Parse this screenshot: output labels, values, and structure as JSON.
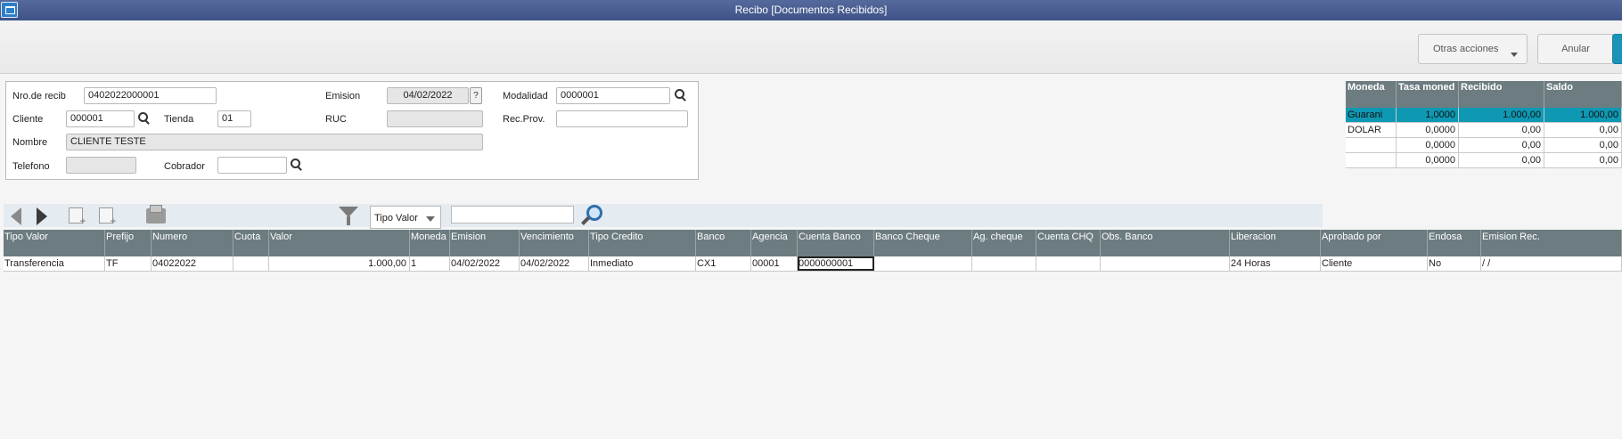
{
  "window": {
    "title": "Recibo [Documentos Recibidos]"
  },
  "actions": {
    "more_label": "Otras acciones",
    "cancel_label": "Anular"
  },
  "form": {
    "nro_recib": {
      "label": "Nro.de recib",
      "value": "0402022000001"
    },
    "emision": {
      "label": "Emision",
      "value": "04/02/2022",
      "help": "?"
    },
    "modalidad": {
      "label": "Modalidad",
      "value": "0000001"
    },
    "cliente": {
      "label": "Cliente",
      "value": "000001"
    },
    "tienda": {
      "label": "Tienda",
      "value": "01"
    },
    "ruc": {
      "label": "RUC",
      "value": ""
    },
    "rec_prov": {
      "label": "Rec.Prov.",
      "value": ""
    },
    "nombre": {
      "label": "Nombre",
      "value": "CLIENTE TESTE"
    },
    "telefono": {
      "label": "Telefono",
      "value": ""
    },
    "cobrador": {
      "label": "Cobrador",
      "value": ""
    }
  },
  "currency_table": {
    "columns": [
      "Moneda",
      "Tasa moned",
      "Recibido",
      "Saldo"
    ],
    "rows": [
      {
        "moneda": "Guarani",
        "tasa": "1,0000",
        "recibido": "1.000,00",
        "saldo": "1.000,00"
      },
      {
        "moneda": "DOLAR",
        "tasa": "0,0000",
        "recibido": "0,00",
        "saldo": "0,00"
      },
      {
        "moneda": "",
        "tasa": "0,0000",
        "recibido": "0,00",
        "saldo": "0,00"
      },
      {
        "moneda": "",
        "tasa": "0,0000",
        "recibido": "0,00",
        "saldo": "0,00"
      }
    ]
  },
  "toolbar": {
    "filter_select": "Tipo Valor",
    "search_value": ""
  },
  "grid": {
    "columns": [
      "Tipo Valor",
      "Prefijo",
      "Numero",
      "Cuota",
      "Valor",
      "Moneda",
      "Emision",
      "Vencimiento",
      "Tipo Credito",
      "Banco",
      "Agencia",
      "Cuenta Banco",
      "Banco Cheque",
      "Ag. cheque",
      "Cuenta CHQ",
      "Obs. Banco",
      "Liberacion",
      "Aprobado por",
      "Endosa",
      "Emision Rec."
    ],
    "rows": [
      [
        "Transferencia",
        "TF",
        "04022022",
        "",
        "1.000,00",
        "1",
        "04/02/2022",
        "04/02/2022",
        "Inmediato",
        "CX1",
        "00001",
        "0000000001",
        "",
        "",
        "",
        "",
        "24 Horas",
        "Cliente",
        "No",
        " /  /"
      ]
    ]
  },
  "colors": {
    "title_bar": "#4a5d92",
    "grid_header": "#6c7c80",
    "selected_row": "#0f98b3"
  }
}
